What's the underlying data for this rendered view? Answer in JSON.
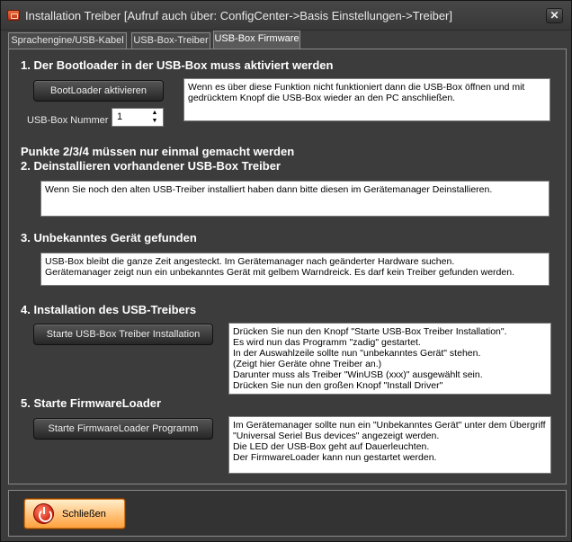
{
  "window": {
    "title": "Installation Treiber [Aufruf auch über: ConfigCenter->Basis Einstellungen->Treiber]",
    "close_glyph": "✕"
  },
  "tabs": [
    {
      "label": "Sprachengine/USB-Kabel",
      "active": false
    },
    {
      "label": "USB-Box-Treiber",
      "active": false
    },
    {
      "label": "USB-Box Firmware",
      "active": true
    }
  ],
  "sections": {
    "s1": {
      "heading": "1. Der Bootloader in der USB-Box muss aktiviert werden",
      "button": "BootLoader aktivieren",
      "box_number_label": "USB-Box Nummer",
      "box_number_value": "1",
      "info": [
        "Wenn es über diese Funktion nicht funktioniert dann die USB-Box öffnen und mit",
        "gedrücktem Knopf die USB-Box wieder an den PC anschließen."
      ]
    },
    "note": "Punkte 2/3/4 müssen nur einmal gemacht werden",
    "s2": {
      "heading": "2. Deinstallieren vorhandener USB-Box Treiber",
      "info": [
        "Wenn Sie noch den alten USB-Treiber installiert haben dann bitte diesen im Gerätemanager Deinstallieren."
      ]
    },
    "s3": {
      "heading": "3. Unbekanntes Gerät gefunden",
      "info": [
        "USB-Box bleibt die ganze Zeit angesteckt. Im Gerätemanager nach geänderter Hardware suchen.",
        "Gerätemanager zeigt nun ein unbekanntes Gerät mit gelbem Warndreick. Es darf kein Treiber gefunden werden."
      ]
    },
    "s4": {
      "heading": "4. Installation des USB-Treibers",
      "button": "Starte USB-Box Treiber Installation",
      "info": [
        "Drücken Sie nun den Knopf \"Starte USB-Box Treiber Installation\".",
        "Es wird nun das Programm \"zadig\" gestartet.",
        "In der Auswahlzeile sollte nun \"unbekanntes Gerät\" stehen.",
        "(Zeigt hier Geräte ohne Treiber an.)",
        "Darunter muss als Treiber \"WinUSB (xxx)\"  ausgewählt sein.",
        "Drücken Sie nun den großen Knopf \"Install Driver\""
      ]
    },
    "s5": {
      "heading": "5. Starte FirmwareLoader",
      "button": "Starte FirmwareLoader Programm",
      "info": [
        "Im Gerätemanager sollte nun ein \"Unbekanntes Gerät\" unter dem Übergriff",
        "\"Universal Seriel Bus devices\" angezeigt werden.",
        "Die LED der USB-Box geht auf Dauerleuchten.",
        "Der FirmwareLoader kann nun gestartet werden."
      ]
    }
  },
  "footer": {
    "close_button": "Schließen"
  },
  "colors": {
    "background": "#3c3c3c",
    "text": "#ffffff",
    "close_button_accent": "#ffb45a",
    "power_icon": "#d12010"
  },
  "icons": [
    "app-icon",
    "close-icon",
    "spinner-up-icon",
    "spinner-down-icon",
    "power-icon"
  ]
}
